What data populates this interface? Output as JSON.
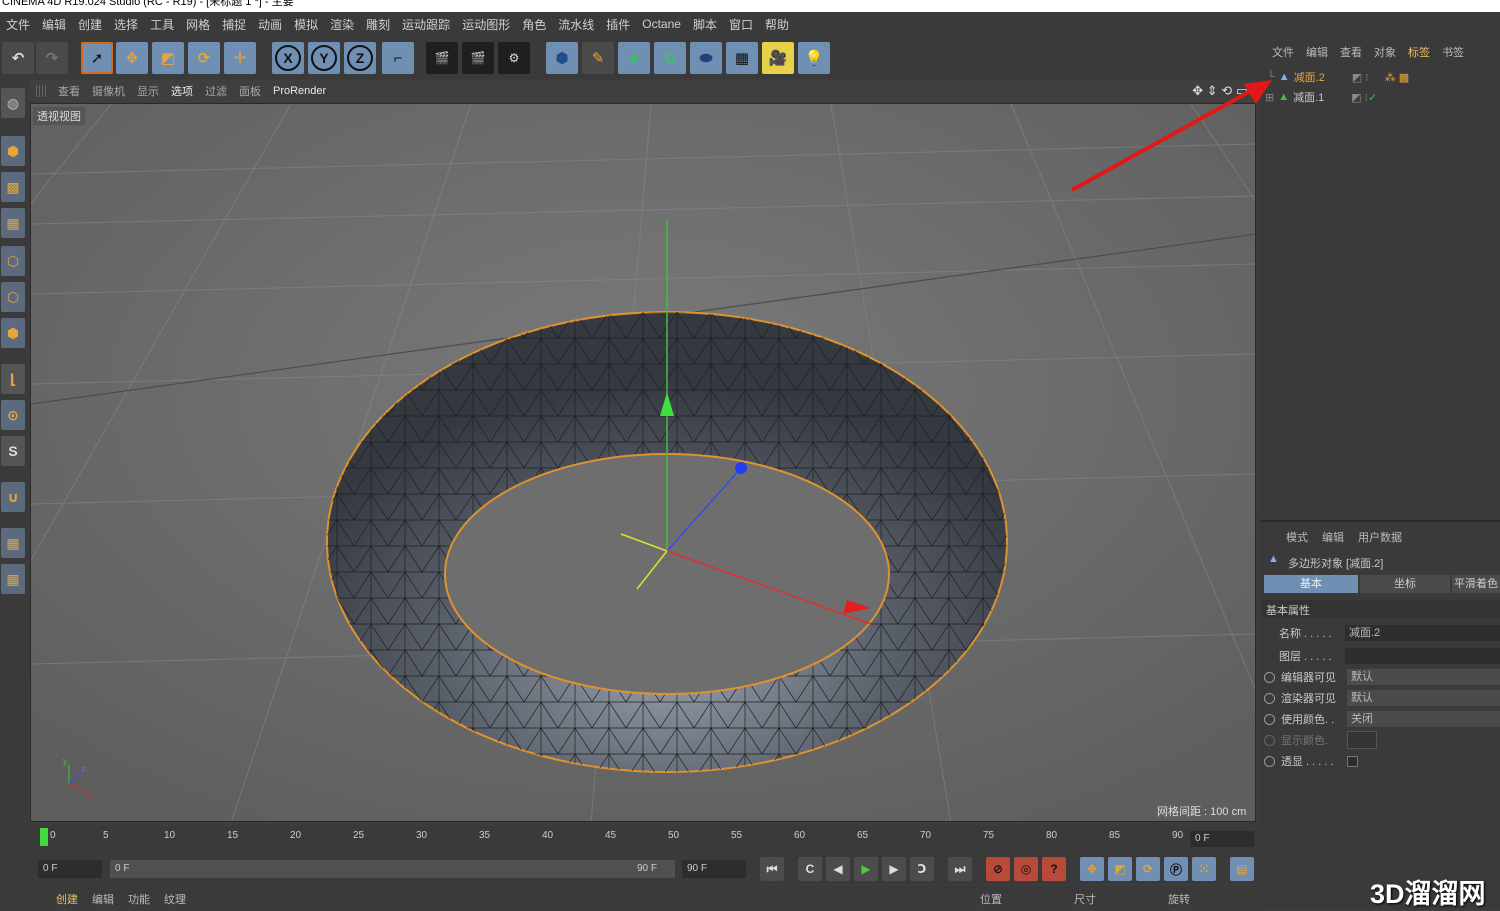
{
  "window": {
    "title": "CINEMA 4D R19.024 Studio (RC - R19) - [未标题 1 *] - 主要"
  },
  "menu": [
    "文件",
    "编辑",
    "创建",
    "选择",
    "工具",
    "网格",
    "捕捉",
    "动画",
    "模拟",
    "渲染",
    "雕刻",
    "运动跟踪",
    "运动图形",
    "角色",
    "流水线",
    "插件",
    "Octane",
    "脚本",
    "窗口",
    "帮助"
  ],
  "toolbar": {
    "x_label": "X",
    "y_label": "Y",
    "z_label": "Z"
  },
  "viewport": {
    "menu": [
      "查看",
      "摄像机",
      "显示",
      "选项",
      "过滤",
      "面板",
      "ProRender"
    ],
    "active_menu": "选项",
    "label": "透视视图",
    "grid_info": "网格间距 : 100 cm",
    "axis_x": "x",
    "axis_y": "y",
    "axis_z": "z"
  },
  "timeline": {
    "ticks": [
      "0",
      "5",
      "10",
      "15",
      "20",
      "25",
      "30",
      "35",
      "40",
      "45",
      "50",
      "55",
      "60",
      "65",
      "70",
      "75",
      "80",
      "85",
      "90"
    ],
    "current_frame": "0 F"
  },
  "transport": {
    "start_field": "0 F",
    "range_start": "0 F",
    "range_end": "90 F",
    "end_field": "90 F"
  },
  "bottom_tabs": [
    "创建",
    "编辑",
    "功能",
    "纹理"
  ],
  "coord_headers": [
    "位置",
    "尺寸",
    "旋转"
  ],
  "object_manager": {
    "menu": [
      "文件",
      "编辑",
      "查看",
      "对象",
      "标签",
      "书签"
    ],
    "objects": [
      {
        "name": "减面.2",
        "selected": true
      },
      {
        "name": "减面.1",
        "selected": false
      }
    ]
  },
  "attribute_manager": {
    "menu": [
      "模式",
      "编辑",
      "用户数据"
    ],
    "object_title": "多边形对象 [减面.2]",
    "tabs": [
      "基本",
      "坐标",
      "平滑着色"
    ],
    "active_tab": "基本",
    "section": "基本属性",
    "props": [
      {
        "label": "名称 . . . . .",
        "value": "减面.2"
      },
      {
        "label": "图层 . . . . .",
        "value": ""
      },
      {
        "label": "编辑器可见",
        "value": "默认"
      },
      {
        "label": "渲染器可见",
        "value": "默认"
      },
      {
        "label": "使用颜色. .",
        "value": "关闭"
      },
      {
        "label": "显示颜色.",
        "value": ""
      },
      {
        "label": "透显 . . . . .",
        "value": ""
      }
    ]
  },
  "watermark": "3D溜溜网",
  "colors": {
    "accent": "#e8a33a",
    "highlight_blue": "#6f8fb3",
    "selection_orange": "#d46a1b",
    "arrow_red": "#e01818"
  }
}
